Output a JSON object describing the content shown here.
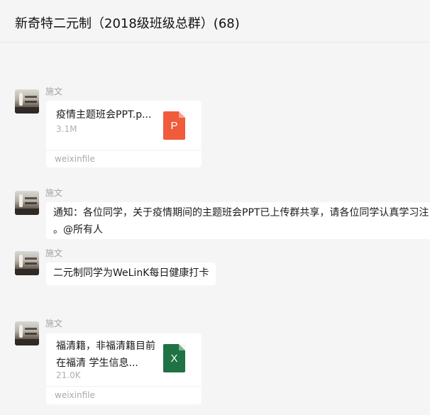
{
  "chat": {
    "title": "新奇特二元制（2018级班级总群）(68)"
  },
  "messages": [
    {
      "sender": "施文",
      "type": "file",
      "file_name": "疫情主题班会PPT.p...",
      "file_size": "3.1M",
      "source": "weixinfile",
      "icon": "ppt-file-icon",
      "icon_letter": "P",
      "icon_color": "#f05b3c"
    },
    {
      "sender": "施文",
      "type": "text",
      "lines": [
        "通知：各位同学，关于疫情期间的主题班会PPT已上传群共享，请各位同学认真学习注",
        "。@所有人"
      ]
    },
    {
      "sender": "施文",
      "type": "text",
      "lines": [
        "二元制同学为WeLinK每日健康打卡"
      ]
    },
    {
      "sender": "施文",
      "type": "file",
      "file_name": "福清籍，非福清籍目前在福清 学生信息...",
      "file_size": "21.0K",
      "source": "weixinfile",
      "icon": "excel-file-icon",
      "icon_letter": "X",
      "icon_color": "#1f7244"
    }
  ]
}
